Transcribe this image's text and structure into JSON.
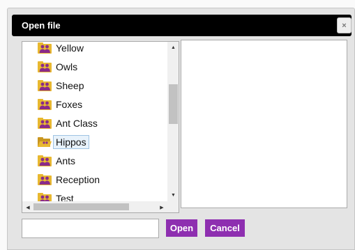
{
  "dialog": {
    "title": "Open file",
    "close_glyph": "×"
  },
  "tree": {
    "items": [
      {
        "label": "Yellow",
        "icon": "group-folder-icon",
        "selected": false
      },
      {
        "label": "Owls",
        "icon": "group-folder-icon",
        "selected": false
      },
      {
        "label": "Sheep",
        "icon": "group-folder-icon",
        "selected": false
      },
      {
        "label": "Foxes",
        "icon": "group-folder-icon",
        "selected": false
      },
      {
        "label": "Ant Class",
        "icon": "group-folder-icon",
        "selected": false
      },
      {
        "label": "Hippos",
        "icon": "open-folder-icon",
        "selected": true
      },
      {
        "label": "Ants",
        "icon": "group-folder-icon",
        "selected": false
      },
      {
        "label": "Reception",
        "icon": "group-folder-icon",
        "selected": false
      },
      {
        "label": "Test",
        "icon": "group-folder-icon",
        "selected": false
      }
    ]
  },
  "filename": {
    "value": "",
    "placeholder": ""
  },
  "buttons": {
    "open_label": "Open",
    "cancel_label": "Cancel"
  },
  "colors": {
    "accent": "#8e2fb0",
    "titlebar": "#000000",
    "folder": "#e8b830",
    "group_figure": "#8a2a8a"
  }
}
